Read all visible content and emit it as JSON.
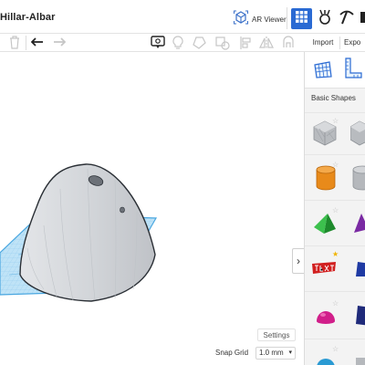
{
  "header": {
    "design_title": "Hillar-Albar",
    "ar_viewer_label": "AR Viewer"
  },
  "toolbar": {
    "import_label": "Import",
    "export_label": "Expo"
  },
  "panel": {
    "section_title": "Basic Shapes",
    "shapes": [
      {
        "name": "Box (hole)",
        "color": "#a9acb0"
      },
      {
        "name": "Box",
        "color": "#a9acb0"
      },
      {
        "name": "Cylinder",
        "color": "#e88a1a"
      },
      {
        "name": "Cylinder",
        "color": "#a9acb0"
      },
      {
        "name": "Pyramid",
        "color": "#2aa33a"
      },
      {
        "name": "Roof",
        "color": "#7a2aa3"
      },
      {
        "name": "Text",
        "color": "#d11f1f"
      },
      {
        "name": "Shape",
        "color": "#1f3aa3"
      },
      {
        "name": "Sphere",
        "color": "#d11f8a"
      },
      {
        "name": "Sphere",
        "color": "#1f2a7a"
      }
    ]
  },
  "workplane": {
    "settings_label": "Settings",
    "snap_grid_label": "Snap Grid",
    "snap_grid_value": "1.0 mm",
    "grid_color": "#4aa7e0",
    "shape_color": "#d3d6da"
  }
}
